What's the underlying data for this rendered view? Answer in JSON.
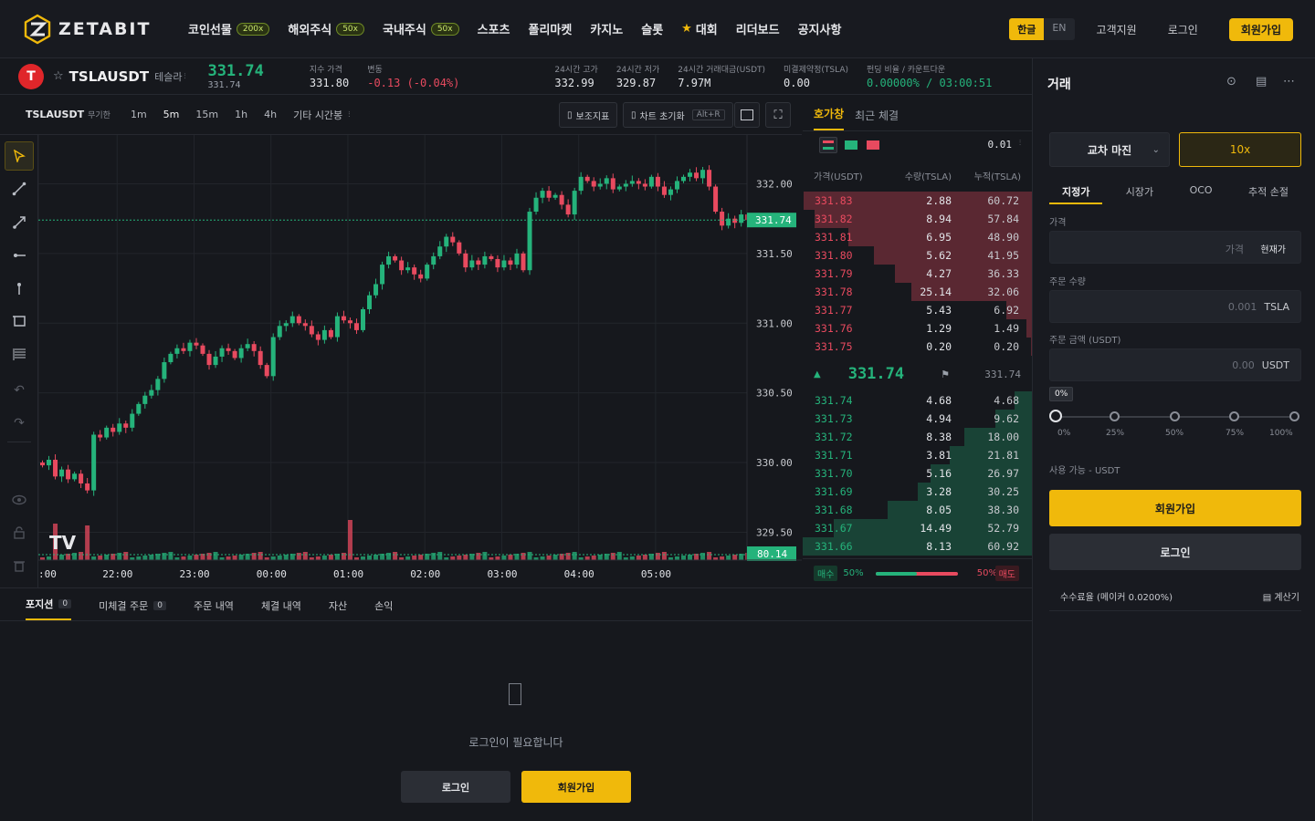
{
  "brand": {
    "name": "ZETABIT"
  },
  "nav": {
    "items": [
      {
        "label": "코인선물",
        "badge": "200x"
      },
      {
        "label": "해외주식",
        "badge": "50x"
      },
      {
        "label": "국내주식",
        "badge": "50x"
      },
      {
        "label": "스포츠",
        "badge": ""
      },
      {
        "label": "폴리마켓",
        "badge": ""
      },
      {
        "label": "카지노",
        "badge": ""
      },
      {
        "label": "슬롯",
        "badge": ""
      },
      {
        "label": "대회",
        "badge": ""
      },
      {
        "label": "리더보드",
        "badge": ""
      },
      {
        "label": "공지사항",
        "badge": ""
      }
    ],
    "lang_ko": "한글",
    "lang_en": "EN",
    "support": "고객지원",
    "login": "로그인",
    "signup": "회원가입"
  },
  "ticker": {
    "logo_letter": "T",
    "symbol": "TSLAUSDT",
    "name": "테슬라",
    "last": "331.74",
    "last_sub": "331.74",
    "index_label": "지수 가격",
    "index_value": "331.80",
    "change_label": "변동",
    "change_value": "-0.13 (-0.04%)",
    "high_label": "24시간 고가",
    "high_value": "332.99",
    "low_label": "24시간 저가",
    "low_value": "329.87",
    "vol_label": "24시간 거래대금(USDT)",
    "vol_value": "7.97M",
    "oi_label": "미결제약정(TSLA)",
    "oi_value": "0.00",
    "funding_label": "펀딩 비율 / 카운트다운",
    "funding_value": "0.00000% / 03:00:51"
  },
  "chart_toolbar": {
    "symbol": "TSLAUSDT",
    "sub": "무기한",
    "timeframes": [
      "1m",
      "5m",
      "15m",
      "1h",
      "4h"
    ],
    "active_tf": "5m",
    "more": "기타 시간봉",
    "indicators": "보조지표",
    "reset": "차트 초기화",
    "reset_key": "Alt+R"
  },
  "chart_data": {
    "type": "candlestick",
    "title": "",
    "y_ticks": [
      332.0,
      331.5,
      331.0,
      330.5,
      330.0,
      329.5
    ],
    "ylim": [
      329.3,
      332.35
    ],
    "x_ticks": [
      ":00",
      "22:00",
      "23:00",
      "00:00",
      "01:00",
      "02:00",
      "03:00",
      "04:00",
      "05:00"
    ],
    "last_price": 331.74,
    "volume_tag": "80.14",
    "watermark": "TV",
    "up_color": "#25b37b",
    "down_color": "#e84a5f",
    "close_series": [
      329.98,
      330.02,
      329.9,
      329.95,
      329.88,
      329.92,
      329.85,
      329.8,
      330.2,
      330.18,
      330.25,
      330.22,
      330.28,
      330.25,
      330.35,
      330.42,
      330.48,
      330.52,
      330.6,
      330.72,
      330.78,
      330.82,
      330.8,
      330.86,
      330.84,
      330.78,
      330.7,
      330.76,
      330.82,
      330.8,
      330.75,
      330.82,
      330.85,
      330.8,
      330.7,
      330.62,
      330.9,
      330.98,
      331.0,
      331.05,
      331.0,
      330.98,
      330.92,
      330.88,
      330.95,
      330.9,
      331.05,
      331.02,
      331.0,
      330.95,
      331.1,
      331.2,
      331.28,
      331.42,
      331.48,
      331.45,
      331.38,
      331.4,
      331.35,
      331.32,
      331.42,
      331.48,
      331.55,
      331.62,
      331.58,
      331.5,
      331.4,
      331.45,
      331.42,
      331.48,
      331.46,
      331.4,
      331.45,
      331.42,
      331.5,
      331.38,
      331.8,
      331.9,
      331.95,
      331.9,
      331.92,
      331.85,
      331.78,
      331.95,
      332.05,
      332.02,
      331.98,
      332.0,
      332.04,
      331.96,
      331.98,
      332.0,
      332.02,
      332.0,
      331.98,
      332.05,
      331.98,
      331.92,
      331.96,
      332.02,
      332.05,
      332.08,
      332.04,
      332.1,
      331.98,
      331.8,
      331.7,
      331.75,
      331.72,
      331.78,
      331.74
    ]
  },
  "orderbook": {
    "tab_book": "호가창",
    "tab_trades": "최근 체결",
    "step": "0.01",
    "col_price": "가격(USDT)",
    "col_qty": "수량(TSLA)",
    "col_cum": "누적(TSLA)",
    "asks": [
      {
        "p": "331.83",
        "q": "2.88",
        "c": "60.72"
      },
      {
        "p": "331.82",
        "q": "8.94",
        "c": "57.84"
      },
      {
        "p": "331.81",
        "q": "6.95",
        "c": "48.90"
      },
      {
        "p": "331.80",
        "q": "5.62",
        "c": "41.95"
      },
      {
        "p": "331.79",
        "q": "4.27",
        "c": "36.33"
      },
      {
        "p": "331.78",
        "q": "25.14",
        "c": "32.06"
      },
      {
        "p": "331.77",
        "q": "5.43",
        "c": "6.92"
      },
      {
        "p": "331.76",
        "q": "1.29",
        "c": "1.49"
      },
      {
        "p": "331.75",
        "q": "0.20",
        "c": "0.20"
      }
    ],
    "mid": "331.74",
    "mid_ref": "331.74",
    "bids": [
      {
        "p": "331.74",
        "q": "4.68",
        "c": "4.68"
      },
      {
        "p": "331.73",
        "q": "4.94",
        "c": "9.62"
      },
      {
        "p": "331.72",
        "q": "8.38",
        "c": "18.00"
      },
      {
        "p": "331.71",
        "q": "3.81",
        "c": "21.81"
      },
      {
        "p": "331.70",
        "q": "5.16",
        "c": "26.97"
      },
      {
        "p": "331.69",
        "q": "3.28",
        "c": "30.25"
      },
      {
        "p": "331.68",
        "q": "8.05",
        "c": "38.30"
      },
      {
        "p": "331.67",
        "q": "14.49",
        "c": "52.79"
      },
      {
        "p": "331.66",
        "q": "8.13",
        "c": "60.92"
      }
    ],
    "max_cum": 60.92,
    "buy_label": "매수",
    "buy_pct": "50%",
    "sell_label": "매도",
    "sell_pct": "50%",
    "buy_fraction": 0.5
  },
  "bottom": {
    "tabs": [
      {
        "label": "포지션",
        "count": "0"
      },
      {
        "label": "미체결 주문",
        "count": "0"
      },
      {
        "label": "주문 내역",
        "count": ""
      },
      {
        "label": "체결 내역",
        "count": ""
      },
      {
        "label": "자산",
        "count": ""
      },
      {
        "label": "손익",
        "count": ""
      }
    ],
    "empty_msg": "로그인이 필요합니다",
    "login": "로그인",
    "signup": "회원가입"
  },
  "trade": {
    "title": "거래",
    "margin_mode": "교차 마진",
    "leverage": "10x",
    "order_tabs": [
      "지정가",
      "시장가",
      "OCO",
      "추적 손절"
    ],
    "price_label": "가격",
    "price_placeholder": "가격",
    "price_btn": "현재가",
    "qty_label": "주문 수량",
    "qty_placeholder": "0.001",
    "qty_unit": "TSLA",
    "amount_label": "주문 금액 (USDT)",
    "amount_placeholder": "0.00",
    "amount_unit": "USDT",
    "pct_tag": "0%",
    "slider_labels": [
      "0%",
      "25%",
      "50%",
      "75%",
      "100%"
    ],
    "slider_value": 0,
    "available": "사용 가능 - USDT",
    "signup": "회원가입",
    "login": "로그인",
    "fee": "수수료율 (메이커 0.0200%)",
    "calc": "계산기"
  },
  "colors": {
    "accent": "#f0b90b",
    "up": "#25b37b",
    "down": "#e84a5f",
    "bg": "#16181d"
  }
}
